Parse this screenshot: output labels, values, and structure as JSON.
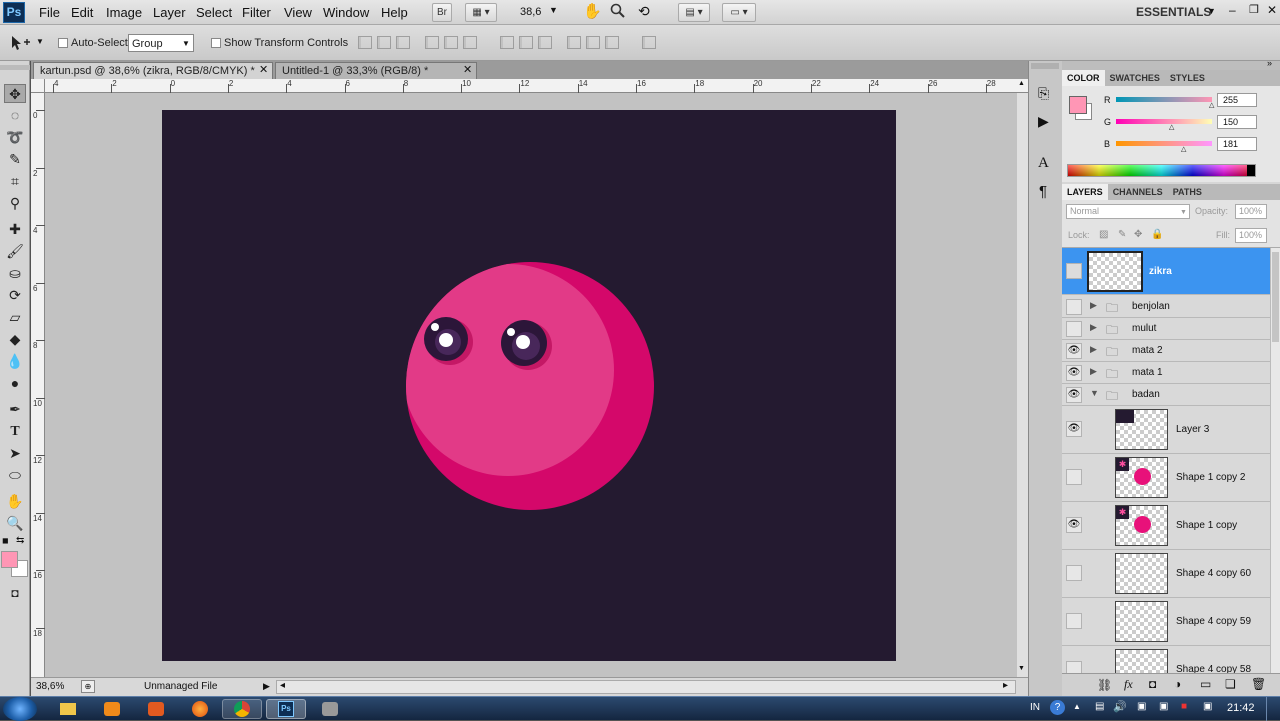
{
  "app": {
    "logo": "Ps",
    "workspace": "ESSENTIALS"
  },
  "menu": [
    "File",
    "Edit",
    "Image",
    "Layer",
    "Select",
    "Filter",
    "View",
    "Window",
    "Help"
  ],
  "menubar_extras": {
    "bridge": "Br",
    "zoom": "38,6"
  },
  "options_bar": {
    "auto_select_label": "Auto-Select:",
    "auto_select_value": "Group",
    "show_transform_label": "Show Transform Controls"
  },
  "tabs": [
    {
      "label": "kartun.psd @ 38,6% (zikra, RGB/8/CMYK) *",
      "active": true
    },
    {
      "label": "Untitled-1 @ 33,3% (RGB/8) *",
      "active": false
    }
  ],
  "ruler": {
    "h_ticks": [
      "4",
      "2",
      "0",
      "2",
      "4",
      "6",
      "8",
      "10",
      "12",
      "14",
      "16",
      "18",
      "20",
      "22",
      "24",
      "26",
      "28"
    ],
    "v_ticks": [
      "0",
      "2",
      "4",
      "6",
      "8",
      "10",
      "12",
      "14",
      "16",
      "18"
    ]
  },
  "status": {
    "zoom": "38,6%",
    "doc_info": "Unmanaged File"
  },
  "color_panel": {
    "tabs": [
      "COLOR",
      "SWATCHES",
      "STYLES"
    ],
    "r_label": "R",
    "g_label": "G",
    "b_label": "B",
    "r": "255",
    "g": "150",
    "b": "181",
    "fg_color": "#ff96b5"
  },
  "layers_panel": {
    "tabs": [
      "LAYERS",
      "CHANNELS",
      "PATHS"
    ],
    "blend_mode": "Normal",
    "opacity_label": "Opacity:",
    "opacity": "100%",
    "lock_label": "Lock:",
    "fill_label": "Fill:",
    "fill": "100%",
    "layers": [
      {
        "name": "zikra",
        "visible": false,
        "selected": true,
        "type": "layer"
      },
      {
        "name": "benjolan",
        "visible": false,
        "type": "group"
      },
      {
        "name": "mulut",
        "visible": false,
        "type": "group"
      },
      {
        "name": "mata 2",
        "visible": true,
        "type": "group"
      },
      {
        "name": "mata 1",
        "visible": true,
        "type": "group"
      },
      {
        "name": "badan",
        "visible": true,
        "type": "group-open"
      },
      {
        "name": "Layer 3",
        "visible": true,
        "type": "layer"
      },
      {
        "name": "Shape 1 copy 2",
        "visible": false,
        "type": "shape"
      },
      {
        "name": "Shape 1 copy",
        "visible": true,
        "type": "shape"
      },
      {
        "name": "Shape 4 copy 60",
        "visible": false,
        "type": "layer"
      },
      {
        "name": "Shape 4 copy 59",
        "visible": false,
        "type": "layer"
      },
      {
        "name": "Shape 4 copy 58",
        "visible": false,
        "type": "layer"
      }
    ]
  },
  "canvas": {
    "background": "#241a30",
    "body_color": "#e23a87",
    "shade_color": "#d4086a"
  },
  "taskbar": {
    "lang": "IN",
    "time": "21:42"
  }
}
